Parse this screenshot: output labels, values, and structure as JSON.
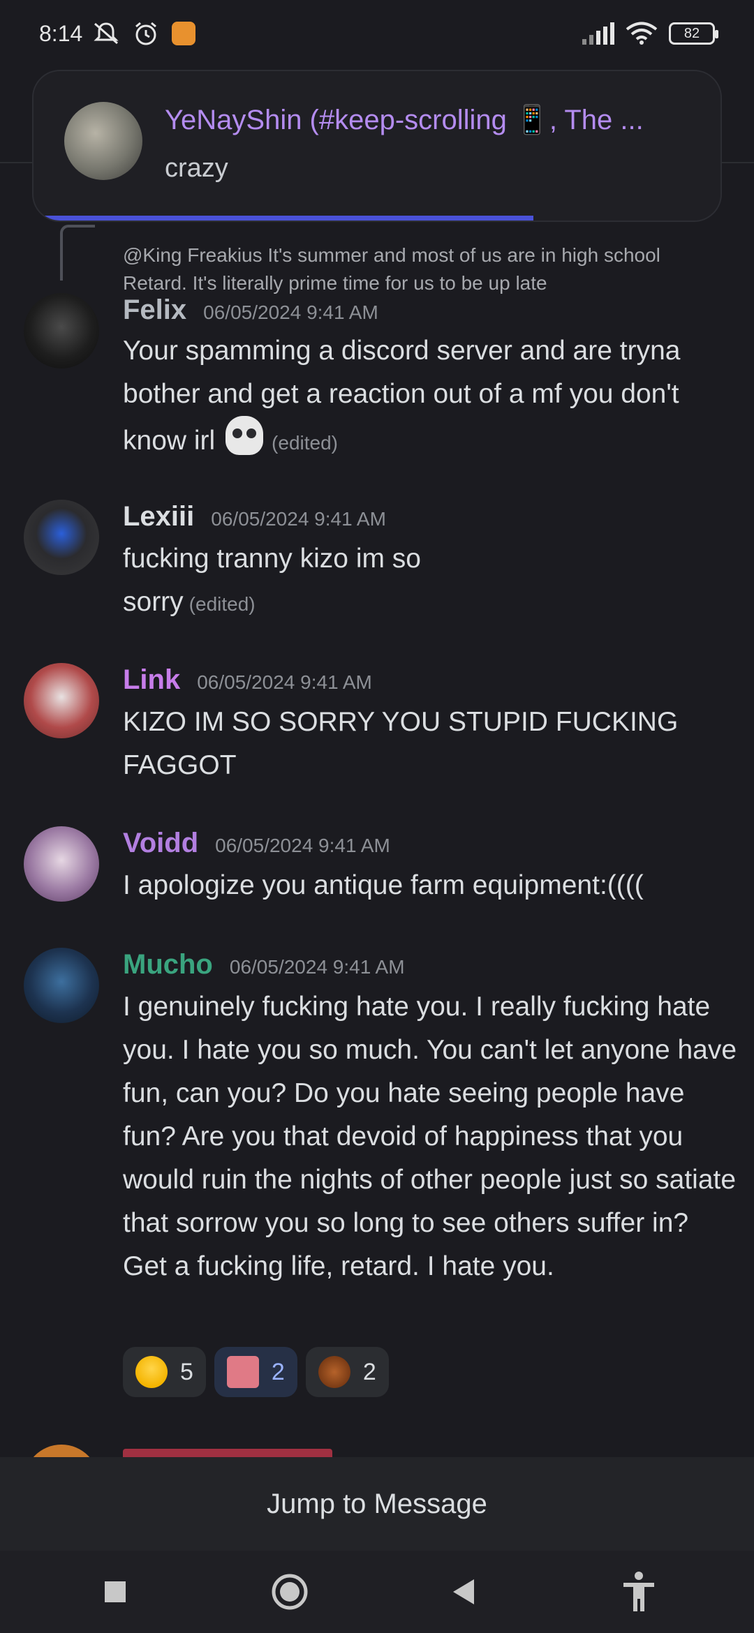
{
  "status_bar": {
    "time": "8:14",
    "battery": "82",
    "icons": [
      "mute-icon",
      "alarm-icon",
      "app-notification-icon",
      "signal-icon",
      "wifi-icon",
      "battery-icon"
    ]
  },
  "notification": {
    "title": "YeNayShin (#keep-scrolling 📱, The ...",
    "body": "crazy"
  },
  "reply_preview": {
    "text": "@King Freakius It's summer and most of us are in high school Retard. It's literally prime time for us to be up late"
  },
  "messages": [
    {
      "username": "Felix",
      "username_color": "#b5bac1",
      "timestamp": "06/05/2024 9:41 AM",
      "text": "Your spamming a discord server and are tryna bother and get a reaction out of a mf you don't know irl",
      "edited": "(edited)"
    },
    {
      "username": "Lexiii",
      "username_color": "#dbdee1",
      "timestamp": "06/05/2024 9:41 AM",
      "text": "fucking tranny kizo im so sorry",
      "edited": "(edited)"
    },
    {
      "username": "Link",
      "username_color": "#c77dea",
      "timestamp": "06/05/2024 9:41 AM",
      "text": "KIZO IM SO SORRY YOU STUPID FUCKING FAGGOT"
    },
    {
      "username": "Voidd",
      "username_color": "#b27fe0",
      "timestamp": "06/05/2024 9:41 AM",
      "text": "I apologize you antique farm equipment:(((("
    },
    {
      "username": "Mucho",
      "username_color": "#3aa47f",
      "timestamp": "06/05/2024 9:41 AM",
      "text": "I genuinely fucking hate you. I really fucking hate you. I hate you so much. You can't let anyone have fun, can you? Do you hate seeing people have fun? Are you that devoid of happiness that you would ruin the nights of other people just so satiate that sorrow you so long to see others suffer in? Get a fucking life, retard. I hate you."
    }
  ],
  "reactions": [
    {
      "emoji": "loudly-crying-face-icon",
      "count": "5"
    },
    {
      "emoji": "custom-emoji-pink-icon",
      "count": "2"
    },
    {
      "emoji": "scorpion-icon",
      "count": "2"
    }
  ],
  "jump_bar": {
    "label": "Jump to Message"
  },
  "colors": {
    "background": "#1b1b20",
    "accent": "#4a52d8"
  }
}
